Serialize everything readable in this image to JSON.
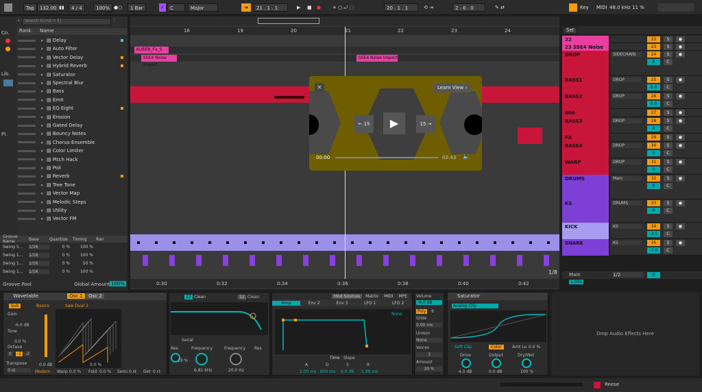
{
  "transport": {
    "tap": "Tap",
    "tempo": "132.00",
    "signature": "4 / 4",
    "zoom": "100%",
    "quantize": "1 Bar",
    "key": "C",
    "scale": "Major",
    "position": "21 .  1 .  1",
    "loop_start": "20 .  1 .  1",
    "loop_length": "2 .  0 .  0",
    "key_label": "Key",
    "midi_label": "MIDI",
    "sample_rate": "48.0 kHz",
    "cpu": "11 %"
  },
  "browser": {
    "search_placeholder": "Search (Cmd + F)",
    "col_rank": "Rank",
    "col_name": "Name",
    "side_labels": [
      "Co.",
      "Lib.",
      "Pl."
    ],
    "items": [
      "Delay",
      "Auto Filter",
      "Vector Delay",
      "Hybrid Reverb",
      "Saturator",
      "Spectral Blur",
      "Bass",
      "Emit",
      "EQ Eight",
      "Erosion",
      "Gated Delay",
      "Bouncy Notes",
      "Chorus-Ensemble",
      "Color Limiter",
      "Pitch Hack",
      "Poil",
      "Reverb",
      "Tree Tone",
      "Vector Map",
      "Melodic Steps",
      "Utility",
      "Vector FM"
    ],
    "dots": [
      "#4bc6d6",
      "",
      "#f39c12",
      "#f39c12",
      "",
      "",
      "",
      "",
      "#f39c12",
      "",
      "",
      "",
      "",
      "",
      "",
      "",
      "#f39c12",
      "",
      "",
      "",
      "",
      ""
    ]
  },
  "groove": {
    "headers": [
      "Groove Name",
      "Base",
      "Quantize",
      "Timing",
      "Ran"
    ],
    "rows": [
      {
        "name": "Swing 5...",
        "base": "1/16",
        "quant": "0 %",
        "timing": "100 %"
      },
      {
        "name": "Swing 1...",
        "base": "1/16",
        "quant": "0 %",
        "timing": "100 %"
      },
      {
        "name": "Swing 1...",
        "base": "1/16",
        "quant": "0 %",
        "timing": "50 %"
      },
      {
        "name": "Swing 1...",
        "base": "1/16",
        "quant": "0 %",
        "timing": "100 %"
      }
    ],
    "pool_label": "Groove Pool",
    "global_label": "Global Amount",
    "global_value": "100%"
  },
  "ruler": {
    "bars": [
      "16",
      "19",
      "20",
      "21",
      "22",
      "23",
      "24"
    ],
    "times": [
      "0:30",
      "0:32",
      "0:34",
      "0:36",
      "0:38",
      "0:40",
      "0:42"
    ],
    "page": "1/8"
  },
  "clips": {
    "kuren": "KUREN_Fx_S",
    "noise1": "SSE4 Noise Impact",
    "noise2": "SSE4 Noise Impact"
  },
  "video": {
    "learn": "Learn View",
    "back": "15",
    "fwd": "15",
    "time": "00:00",
    "duration": "02:43"
  },
  "set_label": "Set",
  "tracks": [
    {
      "name": "22 KUREN_Fx_S",
      "route": "",
      "vol": "22",
      "pan": "",
      "color": "#e83fa0",
      "h": 11
    },
    {
      "name": "23 SSE4 Noise I",
      "route": "",
      "vol": "23",
      "pan": "",
      "color": "#e83fa0",
      "h": 11
    },
    {
      "name": "DROP",
      "route": "SIDECHAIN",
      "vol": "24",
      "pan": "0",
      "color": "#c8163a",
      "h": 37
    },
    {
      "name": "BASS1",
      "route": "DROP",
      "vol": "25",
      "pan": "6.0",
      "color": "#c8163a",
      "h": 24
    },
    {
      "name": "BASS2",
      "route": "DROP",
      "vol": "26",
      "pan": "6.0",
      "color": "#c8163a",
      "h": 24
    },
    {
      "name": "808",
      "route": "",
      "vol": "27",
      "pan": "",
      "color": "#c8163a",
      "h": 12
    },
    {
      "name": "BASS3",
      "route": "DROP",
      "vol": "28",
      "pan": "0",
      "color": "#c8163a",
      "h": 24
    },
    {
      "name": "FX",
      "route": "",
      "vol": "29",
      "pan": "",
      "color": "#c8163a",
      "h": 12
    },
    {
      "name": "BASS4",
      "route": "DROP",
      "vol": "30",
      "pan": "0",
      "color": "#c8163a",
      "h": 24
    },
    {
      "name": "WARP",
      "route": "DROP",
      "vol": "31",
      "pan": "0",
      "color": "#c8163a",
      "h": 24
    },
    {
      "name": "DRUMS",
      "route": "Main",
      "vol": "32",
      "pan": "0",
      "color": "#7d3fd6",
      "h": 36
    },
    {
      "name": "KS",
      "route": "DRUMS",
      "vol": "33",
      "pan": "0",
      "color": "#7d3fd6",
      "h": 34
    },
    {
      "name": "KICK",
      "route": "KS",
      "vol": "34",
      "pan": "-3.5",
      "color": "#a89cf0",
      "h": 24
    },
    {
      "name": "SNARE",
      "route": "KS",
      "vol": "35",
      "pan": "-7.0",
      "color": "#7d3fd6",
      "h": 24
    }
  ],
  "main": {
    "name": "Main",
    "route": "1/2",
    "vol": "0",
    "pan": "0",
    "tempo_scale": "1.00x"
  },
  "wavetable": {
    "title": "Wavetable",
    "osc1": "Osc 1",
    "osc2": "Osc 2",
    "sub": "Sub",
    "category": "Basics",
    "wave": "Saw Dual 3",
    "gain": "Gain",
    "gain_val": "-6.0 dB",
    "tone": "Tone",
    "tone_val": "0.0 %",
    "octave": "Octave",
    "oct_vals": [
      "0",
      "-1",
      "-2"
    ],
    "transpose": "Transpose",
    "transpose_val": "0 st",
    "osc_gain": "0.0 dB",
    "osc_pan": "0.0 %",
    "modern": "Modern",
    "warp": "Warp",
    "warp_val": "0.0 %",
    "fold": "Fold",
    "fold_val": "0.0 %",
    "semi": "Semi",
    "semi_val": "0 st",
    "det": "Det",
    "det_val": "0 ct",
    "f1": "Clean",
    "f2": "Clean",
    "f1n": "12",
    "f2n": "12",
    "serial": "Serial",
    "res": "Res",
    "res_val": "19 %",
    "freq": "Frequency",
    "freq_val": "6.81 kHz",
    "freq2_val": "20.0 Hz",
    "res2": "Res",
    "tabs": [
      "Mod Sources",
      "Matrix",
      "MIDI",
      "MPE"
    ],
    "env": [
      "Amp",
      "Env 2",
      "Env 3",
      "LFO 1",
      "LFO 2"
    ],
    "none": "None",
    "time": "Time",
    "slope": "Slope",
    "adsr": [
      "A",
      "D",
      "S",
      "R"
    ],
    "adsr_vals": [
      "1.00 ms",
      "600 ms",
      "0.0 dB",
      "1.99 ms"
    ],
    "volume": "Volume",
    "volume_val": "-9.0 dB",
    "poly": "Poly",
    "poly_n": "8",
    "glide": "Glide",
    "glide_val": "0.00 ms",
    "unison": "Unison",
    "unison_val": "None",
    "voices": "Voices",
    "voices_val": "3",
    "amount": "Amount",
    "amount_val": "30 %"
  },
  "saturator": {
    "title": "Saturator",
    "mode": "Analog Clip",
    "soft": "Soft Clip",
    "color": "Color",
    "amt": "Amt Lo",
    "amt_val": "0.0 %",
    "drive": "Drive",
    "drive_val": "4.0 dB",
    "output": "Output",
    "output_val": "0.0 dB",
    "drywet": "Dry/Wet",
    "drywet_val": "100 %"
  },
  "drop_hint": "Drop Audio Effects Here",
  "footer": {
    "track": "Reese"
  }
}
